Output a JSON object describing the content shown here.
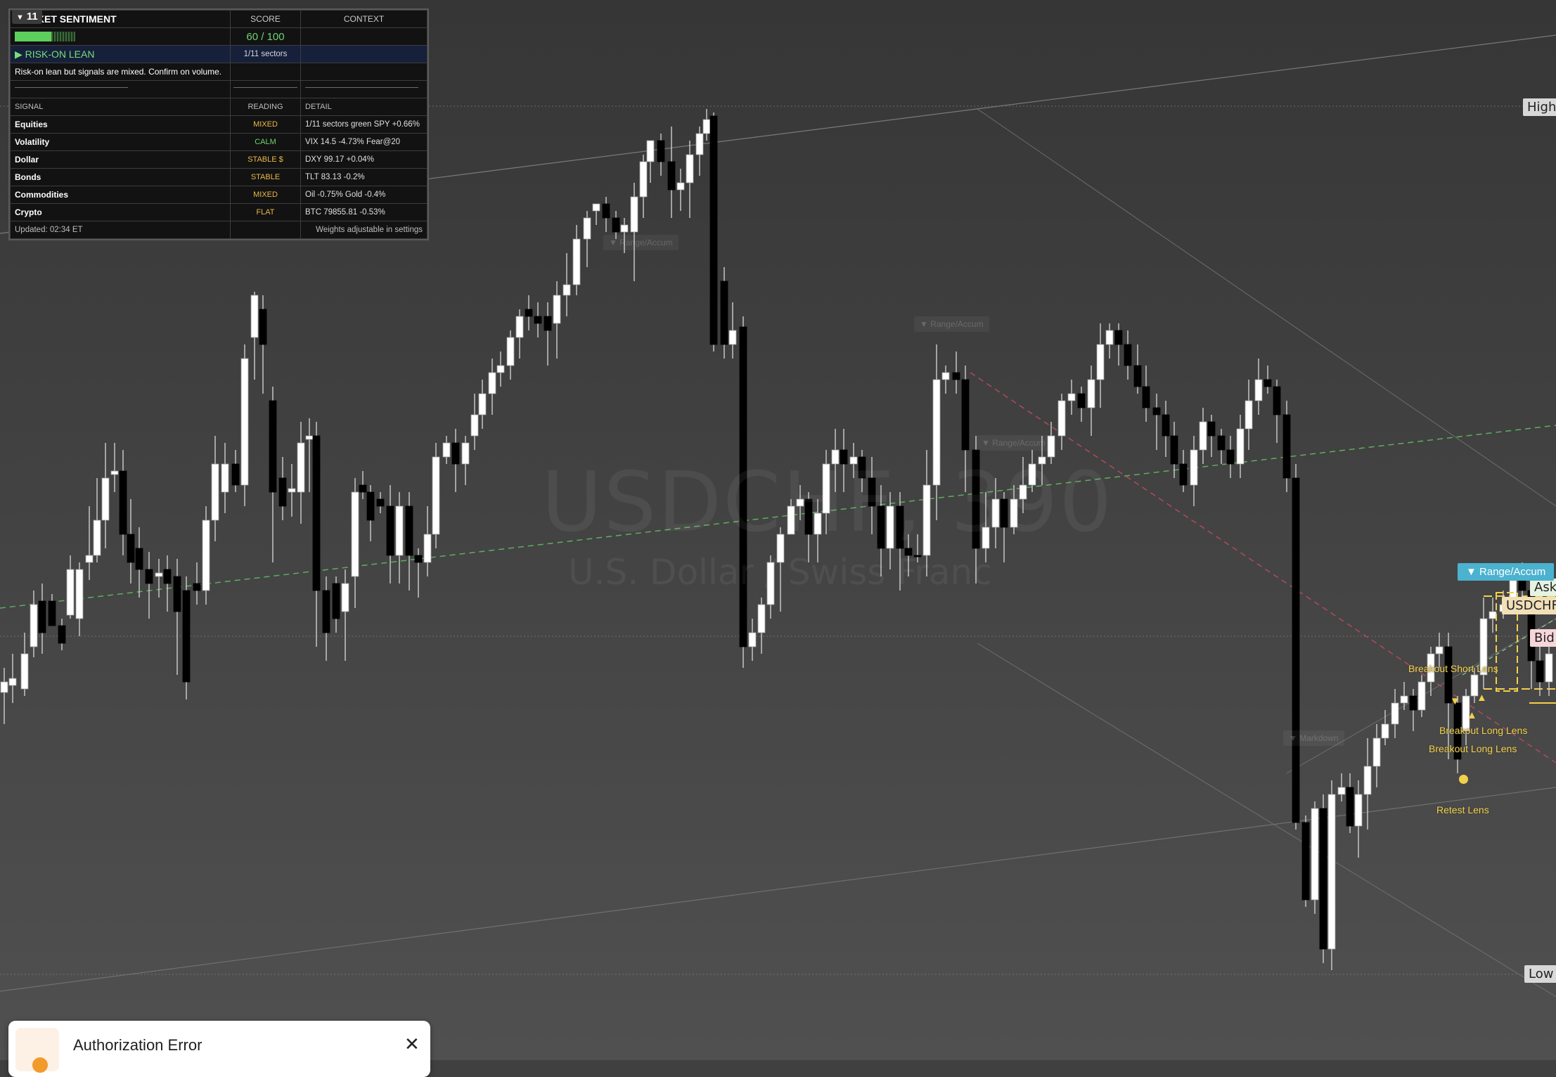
{
  "chart": {
    "symbol": "USDCHF, 390",
    "description": "U.S. Dollar / Swiss Franc",
    "price_labels": {
      "high": "High",
      "low": "Low",
      "ask": "Ask",
      "symbol_tag": "USDCHF",
      "bid": "Bid"
    },
    "range_badge": "▼ Range/Accum",
    "faint_tags": [
      "▼ Range/Accum",
      "▼ Range/Accum",
      "▼ Range/Accum",
      "▼ Markdown"
    ],
    "lens_labels": {
      "breakout_short": "Breakout Short Lens",
      "breakout_long_1": "Breakout Long Lens",
      "breakout_long_2": "Breakout Long Lens",
      "retest": "Retest Lens"
    },
    "colors": {
      "background": "#404040",
      "up_candle": "#ffffff",
      "down_candle": "#000000",
      "accent": "#4bb2cf",
      "lens": "#f2d04b"
    }
  },
  "sentiment": {
    "collapse_count": "11",
    "title": "MARKET SENTIMENT",
    "col_score": "SCORE",
    "col_context": "CONTEXT",
    "score_text": "60 / 100",
    "score_value": 60,
    "lean_label": "▶ RISK-ON LEAN",
    "lean_sectors": "1/11 sectors",
    "message": "Risk-on lean but signals are mixed. Confirm on volume.",
    "signal_headers": {
      "signal": "SIGNAL",
      "reading": "READING",
      "detail": "DETAIL"
    },
    "signals": [
      {
        "name": "Equities",
        "reading": "MIXED",
        "color": "#e8b94a",
        "detail": "1/11 sectors green  SPY +0.66%"
      },
      {
        "name": "Volatility",
        "reading": "CALM",
        "color": "#6fd36f",
        "detail": "VIX 14.5  -4.73%  Fear@20"
      },
      {
        "name": "Dollar",
        "reading": "STABLE $",
        "color": "#e8b94a",
        "detail": "DXY 99.17  +0.04%"
      },
      {
        "name": "Bonds",
        "reading": "STABLE",
        "color": "#e8b94a",
        "detail": "TLT 83.13  -0.2%"
      },
      {
        "name": "Commodities",
        "reading": "MIXED",
        "color": "#e8b94a",
        "detail": "Oil -0.75%  Gold -0.4%"
      },
      {
        "name": "Crypto",
        "reading": "FLAT",
        "color": "#e8b94a",
        "detail": "BTC 79855.81  -0.53%"
      }
    ],
    "updated": "Updated: 02:34 ET",
    "weights_note": "Weights adjustable in settings"
  },
  "toast": {
    "title": "Authorization Error",
    "close": "✕"
  }
}
